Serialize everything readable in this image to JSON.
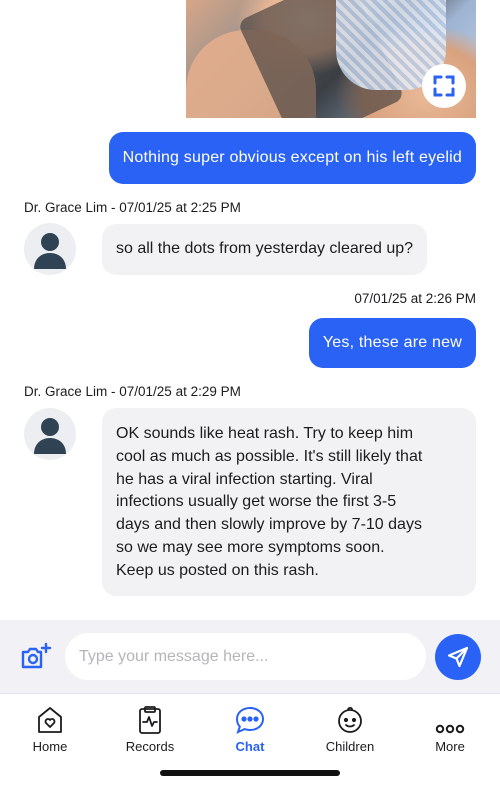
{
  "messages": [
    {
      "kind": "outgoing",
      "text": "Nothing super obvious except on his left eyelid"
    },
    {
      "kind": "incoming",
      "meta": "Dr. Grace Lim - 07/01/25 at 2:25 PM",
      "text": "so all the dots from yesterday cleared up?"
    },
    {
      "kind": "outgoing",
      "meta": "07/01/25 at 2:26 PM",
      "text": "Yes, these are new"
    },
    {
      "kind": "incoming",
      "meta": "Dr. Grace Lim - 07/01/25 at 2:29 PM",
      "lines": [
        "OK sounds like heat rash. Try to keep him",
        "cool as much as possible. It's still likely that",
        "he has a viral infection starting. Viral",
        "infections usually get worse the first 3-5",
        "days and then slowly improve by 7-10 days",
        "so we may see more symptoms soon.",
        "Keep us posted on this rash."
      ]
    }
  ],
  "composer": {
    "placeholder": "Type your message here...",
    "camera_icon": "camera-add-icon",
    "send_icon": "send-icon"
  },
  "tabs": [
    {
      "label": "Home",
      "icon": "home-heart-icon",
      "active": false
    },
    {
      "label": "Records",
      "icon": "clipboard-pulse-icon",
      "active": false
    },
    {
      "label": "Chat",
      "icon": "chat-bubble-icon",
      "active": true
    },
    {
      "label": "Children",
      "icon": "baby-face-icon",
      "active": false
    },
    {
      "label": "More",
      "icon": "more-dots-icon",
      "active": false
    }
  ],
  "colors": {
    "accent": "#2962f5",
    "bubble_incoming": "#f2f2f5",
    "composer_bg": "#f2f2f6"
  }
}
